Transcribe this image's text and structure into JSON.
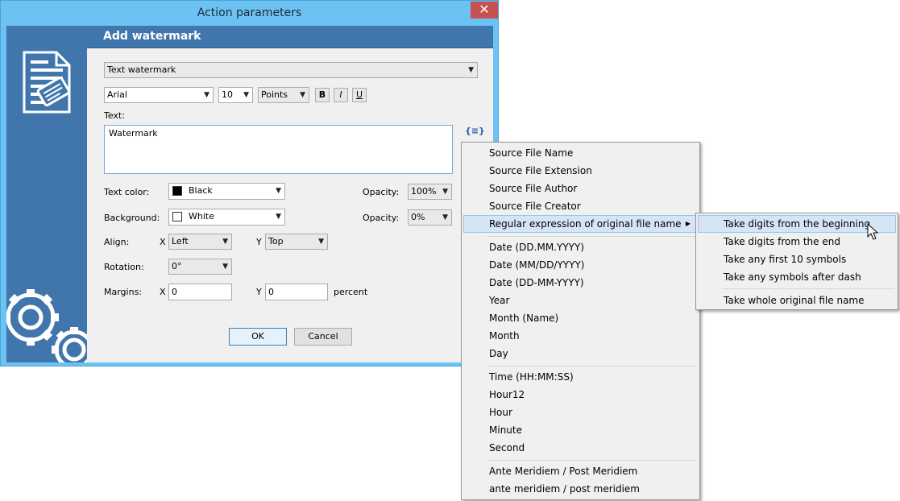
{
  "window": {
    "title": "Action parameters",
    "close_glyph": "✕",
    "header": "Add watermark"
  },
  "form": {
    "watermark_type": "Text watermark",
    "font_name": "Arial",
    "font_size": "10",
    "size_unit": "Points",
    "bold_label": "B",
    "italic_label": "I",
    "underline_label": "U",
    "text_label": "Text:",
    "text_value": "Watermark",
    "macro_icon_glyph": "{≡}",
    "text_color_label": "Text color:",
    "text_color": "Black",
    "text_color_hex": "#000000",
    "background_label": "Background:",
    "background_color": "White",
    "background_color_hex": "#ffffff",
    "opacity_label": "Opacity:",
    "text_opacity": "100%",
    "bg_opacity": "0%",
    "align_label": "Align:",
    "x_label": "X",
    "y_label": "Y",
    "align_x": "Left",
    "align_y": "Top",
    "rotation_label": "Rotation:",
    "rotation": "0°",
    "margins_label": "Margins:",
    "margin_x": "0",
    "margin_y": "0",
    "margins_unit": "percent",
    "ok_label": "OK",
    "cancel_label": "Cancel"
  },
  "menu": {
    "items": [
      "Source File Name",
      "Source File Extension",
      "Source File Author",
      "Source File Creator",
      "Regular expression of original file name",
      "Date (DD.MM.YYYY)",
      "Date (MM/DD/YYYY)",
      "Date (DD-MM-YYYY)",
      "Year",
      "Month (Name)",
      "Month",
      "Day",
      "Time (HH:MM:SS)",
      "Hour12",
      "Hour",
      "Minute",
      "Second",
      "Ante Meridiem / Post Meridiem",
      "ante meridiem / post meridiem"
    ],
    "submenu_arrow": "▶"
  },
  "submenu": {
    "items": [
      "Take digits from the beginning",
      "Take digits from the end",
      "Take any first 10 symbols",
      "Take any symbols after dash",
      "Take whole original file name"
    ]
  },
  "colors": {
    "title_bar": "#6cc2f2",
    "sidebar": "#4176ad",
    "menu_highlight": "#d5e5f5",
    "close_button": "#c75050"
  }
}
